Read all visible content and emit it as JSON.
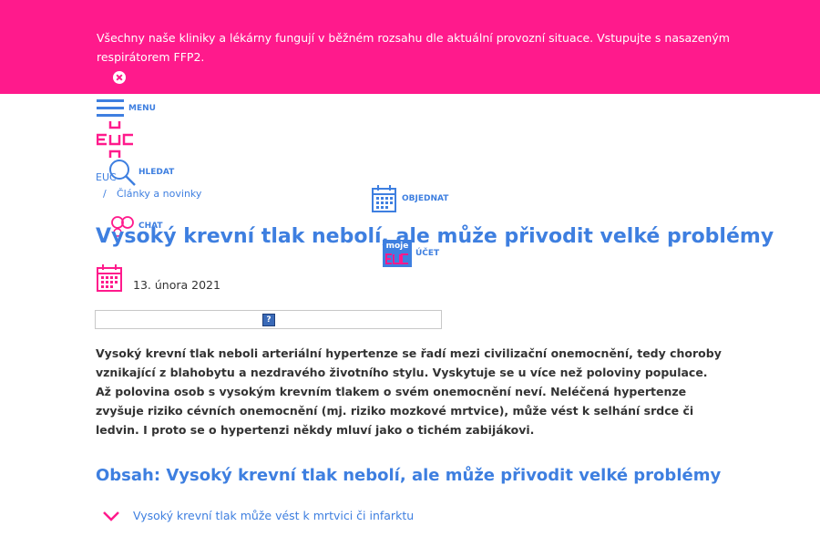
{
  "notice": {
    "text": "Všechny naše kliniky a lékárny fungují v běžném rozsahu dle aktuální provozní situace. Vstupujte s nasazeným respirátorem FFP2."
  },
  "header": {
    "menu_label": "MENU",
    "logo_text": "EUC",
    "search_label": "HLEDAT",
    "order_label": "OBJEDNAT",
    "chat_label": "CHAT",
    "account_badge": "moje",
    "account_label": "ÚČET"
  },
  "breadcrumb": {
    "home": "EUC",
    "separator": "/",
    "current": "Články a novinky"
  },
  "article": {
    "title": "Vysoký krevní tlak nebolí, ale může přivodit velké problémy",
    "date": "13. února 2021",
    "image_placeholder": "?",
    "intro": "Vysoký krevní tlak neboli arteriální hypertenze se řadí mezi civilizační onemocnění, tedy choroby vznikající z blahobytu a nezdravého životního stylu. Vyskytuje se u více než poloviny populace. Až polovina osob s vysokým krevním tlakem o svém onemocnění neví. Neléčená hypertenze zvyšuje riziko cévních onemocnění (mj. riziko mozkové mrtvice), může vést k selhání srdce či ledvin. I proto se o hypertenzi někdy mluví jako o tichém zabijákovi."
  },
  "toc": {
    "title": "Obsah: Vysoký krevní tlak nebolí, ale může přivodit velké problémy",
    "items": [
      {
        "label": "Vysoký krevní tlak může vést k mrtvici či infarktu"
      }
    ]
  },
  "colors": {
    "notice_bg": "#ff1a8c",
    "accent_blue": "#3e7fe0",
    "brand_pink": "#ff1a8c",
    "text": "#333333"
  }
}
